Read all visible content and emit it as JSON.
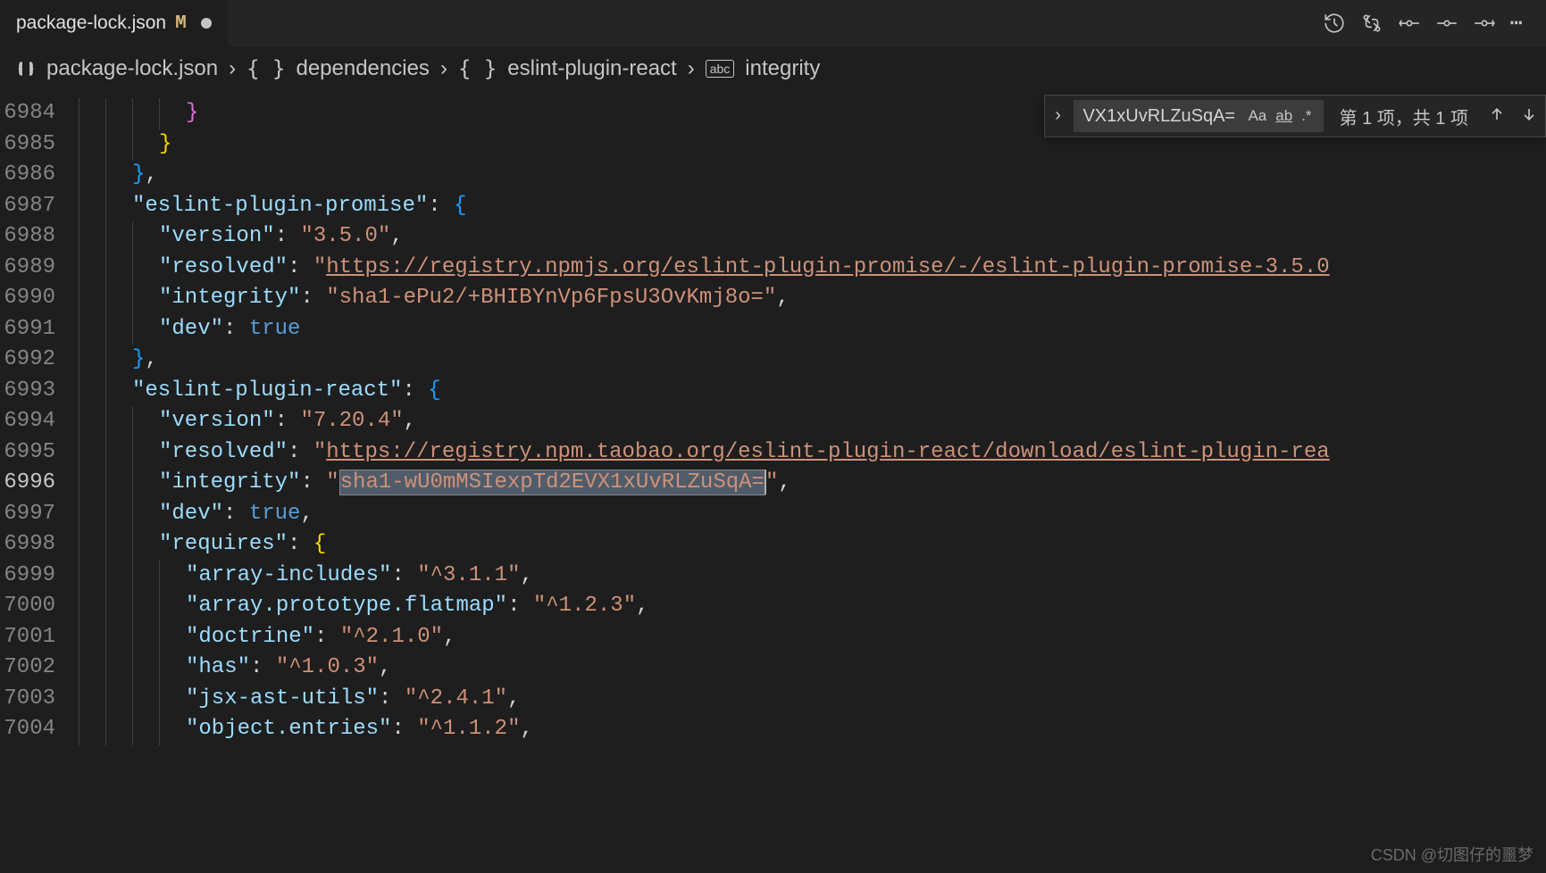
{
  "tab": {
    "filename": "package-lock.json",
    "modified_badge": "M"
  },
  "breadcrumb": {
    "file": "package-lock.json",
    "path": [
      "dependencies",
      "eslint-plugin-react",
      "integrity"
    ]
  },
  "find": {
    "value": "VX1xUvRLZuSqA=",
    "case_label": "Aa",
    "word_label": "ab",
    "regex_label": ".*",
    "result_text": "第 1 项，共 1 项"
  },
  "gutter": {
    "start": 6984,
    "end": 7004,
    "active": 6996
  },
  "code": {
    "lines": [
      {
        "n": 6984,
        "indent": 3,
        "tokens": [
          {
            "t": "brace",
            "c": "purple",
            "v": "}"
          }
        ]
      },
      {
        "n": 6985,
        "indent": 2,
        "tokens": [
          {
            "t": "brace",
            "c": "yellow",
            "v": "}"
          }
        ]
      },
      {
        "n": 6986,
        "indent": 1,
        "tokens": [
          {
            "t": "brace",
            "c": "blue",
            "v": "}"
          },
          {
            "t": "punct",
            "v": ","
          }
        ]
      },
      {
        "n": 6987,
        "indent": 1,
        "tokens": [
          {
            "t": "key",
            "v": "\"eslint-plugin-promise\""
          },
          {
            "t": "punct",
            "v": ": "
          },
          {
            "t": "brace",
            "c": "blue",
            "v": "{"
          }
        ]
      },
      {
        "n": 6988,
        "indent": 2,
        "tokens": [
          {
            "t": "key",
            "v": "\"version\""
          },
          {
            "t": "punct",
            "v": ": "
          },
          {
            "t": "str",
            "v": "\"3.5.0\""
          },
          {
            "t": "punct",
            "v": ","
          }
        ]
      },
      {
        "n": 6989,
        "indent": 2,
        "tokens": [
          {
            "t": "key",
            "v": "\"resolved\""
          },
          {
            "t": "punct",
            "v": ": "
          },
          {
            "t": "str",
            "v": "\""
          },
          {
            "t": "link",
            "v": "https://registry.npmjs.org/eslint-plugin-promise/-/eslint-plugin-promise-3.5.0"
          }
        ]
      },
      {
        "n": 6990,
        "indent": 2,
        "tokens": [
          {
            "t": "key",
            "v": "\"integrity\""
          },
          {
            "t": "punct",
            "v": ": "
          },
          {
            "t": "str",
            "v": "\"sha1-ePu2/+BHIBYnVp6FpsU3OvKmj8o=\""
          },
          {
            "t": "punct",
            "v": ","
          }
        ]
      },
      {
        "n": 6991,
        "indent": 2,
        "tokens": [
          {
            "t": "key",
            "v": "\"dev\""
          },
          {
            "t": "punct",
            "v": ": "
          },
          {
            "t": "bool",
            "v": "true"
          }
        ]
      },
      {
        "n": 6992,
        "indent": 1,
        "tokens": [
          {
            "t": "brace",
            "c": "blue",
            "v": "}"
          },
          {
            "t": "punct",
            "v": ","
          }
        ]
      },
      {
        "n": 6993,
        "indent": 1,
        "tokens": [
          {
            "t": "key",
            "v": "\"eslint-plugin-react\""
          },
          {
            "t": "punct",
            "v": ": "
          },
          {
            "t": "brace",
            "c": "blue",
            "v": "{"
          }
        ]
      },
      {
        "n": 6994,
        "indent": 2,
        "tokens": [
          {
            "t": "key",
            "v": "\"version\""
          },
          {
            "t": "punct",
            "v": ": "
          },
          {
            "t": "str",
            "v": "\"7.20.4\""
          },
          {
            "t": "punct",
            "v": ","
          }
        ]
      },
      {
        "n": 6995,
        "indent": 2,
        "tokens": [
          {
            "t": "key",
            "v": "\"resolved\""
          },
          {
            "t": "punct",
            "v": ": "
          },
          {
            "t": "str",
            "v": "\""
          },
          {
            "t": "link",
            "v": "https://registry.npm.taobao.org/eslint-plugin-react/download/eslint-plugin-rea"
          }
        ]
      },
      {
        "n": 6996,
        "indent": 2,
        "tokens": [
          {
            "t": "key",
            "v": "\"integrity\""
          },
          {
            "t": "punct",
            "v": ": "
          },
          {
            "t": "str",
            "v": "\""
          },
          {
            "t": "highlight",
            "v": "sha1-wU0mMSIexpTd2EVX1xUvRLZuSqA="
          },
          {
            "t": "cursor"
          },
          {
            "t": "str",
            "v": "\""
          },
          {
            "t": "punct",
            "v": ","
          }
        ]
      },
      {
        "n": 6997,
        "indent": 2,
        "tokens": [
          {
            "t": "key",
            "v": "\"dev\""
          },
          {
            "t": "punct",
            "v": ": "
          },
          {
            "t": "bool",
            "v": "true"
          },
          {
            "t": "punct",
            "v": ","
          }
        ]
      },
      {
        "n": 6998,
        "indent": 2,
        "tokens": [
          {
            "t": "key",
            "v": "\"requires\""
          },
          {
            "t": "punct",
            "v": ": "
          },
          {
            "t": "brace",
            "c": "yellow",
            "v": "{"
          }
        ]
      },
      {
        "n": 6999,
        "indent": 3,
        "tokens": [
          {
            "t": "key",
            "v": "\"array-includes\""
          },
          {
            "t": "punct",
            "v": ": "
          },
          {
            "t": "str",
            "v": "\"^3.1.1\""
          },
          {
            "t": "punct",
            "v": ","
          }
        ]
      },
      {
        "n": 7000,
        "indent": 3,
        "tokens": [
          {
            "t": "key",
            "v": "\"array.prototype.flatmap\""
          },
          {
            "t": "punct",
            "v": ": "
          },
          {
            "t": "str",
            "v": "\"^1.2.3\""
          },
          {
            "t": "punct",
            "v": ","
          }
        ]
      },
      {
        "n": 7001,
        "indent": 3,
        "tokens": [
          {
            "t": "key",
            "v": "\"doctrine\""
          },
          {
            "t": "punct",
            "v": ": "
          },
          {
            "t": "str",
            "v": "\"^2.1.0\""
          },
          {
            "t": "punct",
            "v": ","
          }
        ]
      },
      {
        "n": 7002,
        "indent": 3,
        "tokens": [
          {
            "t": "key",
            "v": "\"has\""
          },
          {
            "t": "punct",
            "v": ": "
          },
          {
            "t": "str",
            "v": "\"^1.0.3\""
          },
          {
            "t": "punct",
            "v": ","
          }
        ]
      },
      {
        "n": 7003,
        "indent": 3,
        "tokens": [
          {
            "t": "key",
            "v": "\"jsx-ast-utils\""
          },
          {
            "t": "punct",
            "v": ": "
          },
          {
            "t": "str",
            "v": "\"^2.4.1\""
          },
          {
            "t": "punct",
            "v": ","
          }
        ]
      },
      {
        "n": 7004,
        "indent": 3,
        "tokens": [
          {
            "t": "key",
            "v": "\"object.entries\""
          },
          {
            "t": "punct",
            "v": ": "
          },
          {
            "t": "str",
            "v": "\"^1.1.2\""
          },
          {
            "t": "punct",
            "v": ","
          }
        ]
      }
    ]
  },
  "watermark": "CSDN @切图仔的噩梦"
}
